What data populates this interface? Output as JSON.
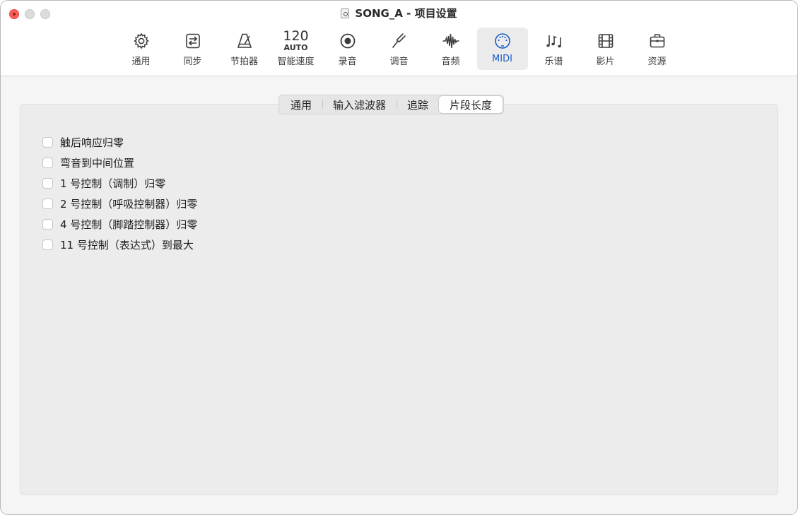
{
  "window": {
    "title": "SONG_A - 项目设置"
  },
  "toolbar": {
    "items": [
      {
        "label": "通用",
        "icon": "gear-icon"
      },
      {
        "label": "同步",
        "icon": "sync-icon"
      },
      {
        "label": "节拍器",
        "icon": "metronome-icon"
      },
      {
        "label": "智能速度",
        "icon": "smart-tempo-icon",
        "tempo": "120",
        "mode": "AUTO"
      },
      {
        "label": "录音",
        "icon": "record-icon"
      },
      {
        "label": "调音",
        "icon": "tuning-fork-icon"
      },
      {
        "label": "音频",
        "icon": "waveform-icon"
      },
      {
        "label": "MIDI",
        "icon": "midi-connector-icon",
        "active": true
      },
      {
        "label": "乐谱",
        "icon": "music-notes-icon"
      },
      {
        "label": "影片",
        "icon": "film-icon"
      },
      {
        "label": "资源",
        "icon": "briefcase-icon"
      }
    ],
    "accent_color": "#1a5dc8"
  },
  "tabs": {
    "items": [
      "通用",
      "输入滤波器",
      "追踪",
      "片段长度"
    ],
    "selected": "片段长度"
  },
  "options": [
    {
      "label": "触后响应归零",
      "checked": false
    },
    {
      "label": "弯音到中间位置",
      "checked": false
    },
    {
      "label": "1 号控制（调制）归零",
      "checked": false
    },
    {
      "label": "2 号控制（呼吸控制器）归零",
      "checked": false
    },
    {
      "label": "4 号控制（脚踏控制器）归零",
      "checked": false
    },
    {
      "label": "11 号控制（表达式）到最大",
      "checked": false
    }
  ]
}
